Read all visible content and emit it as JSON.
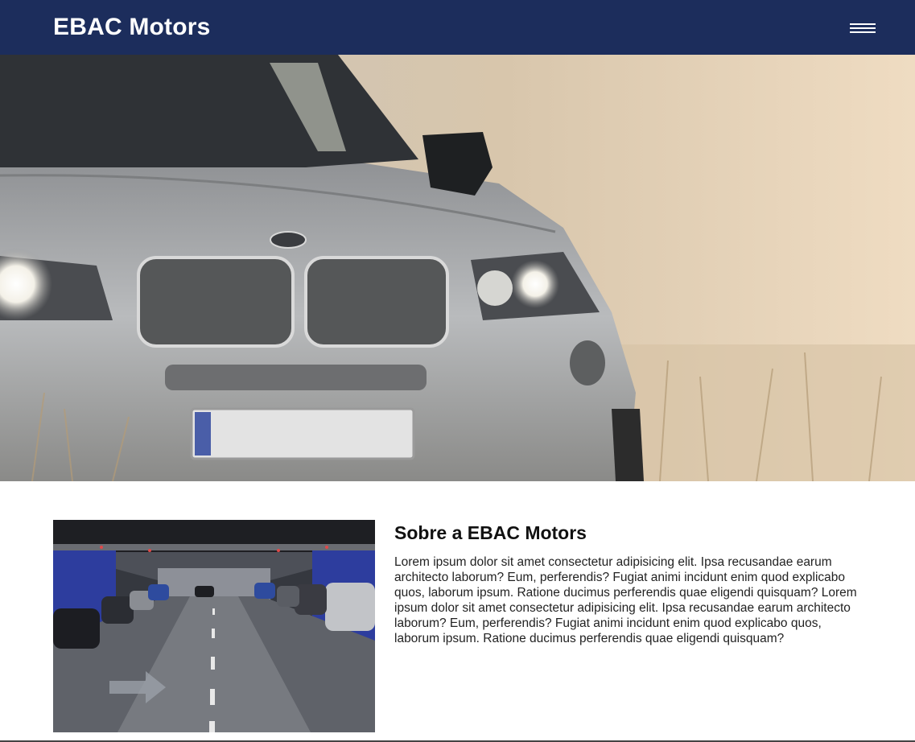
{
  "header": {
    "logo": "EBAC Motors",
    "menu_icon": "hamburger-menu-icon"
  },
  "hero": {
    "image": "silver-suv-front-in-misty-field"
  },
  "about": {
    "image": "parking-garage-with-cars",
    "title": "Sobre a EBAC Motors",
    "paragraph": "Lorem ipsum dolor sit amet consectetur adipisicing elit. Ipsa recusandae earum architecto laborum? Eum, perferendis? Fugiat animi incidunt enim quod explicabo quos, laborum ipsum. Ratione ducimus perferendis quae eligendi quisquam? Lorem ipsum dolor sit amet consectetur adipisicing elit. Ipsa recusandae earum architecto laborum? Eum, perferendis? Fugiat animi incidunt enim quod explicabo quos, laborum ipsum. Ratione ducimus perferendis quae eligendi quisquam?"
  },
  "colors": {
    "header_bg": "#1c2d5c",
    "header_text": "#ffffff"
  }
}
